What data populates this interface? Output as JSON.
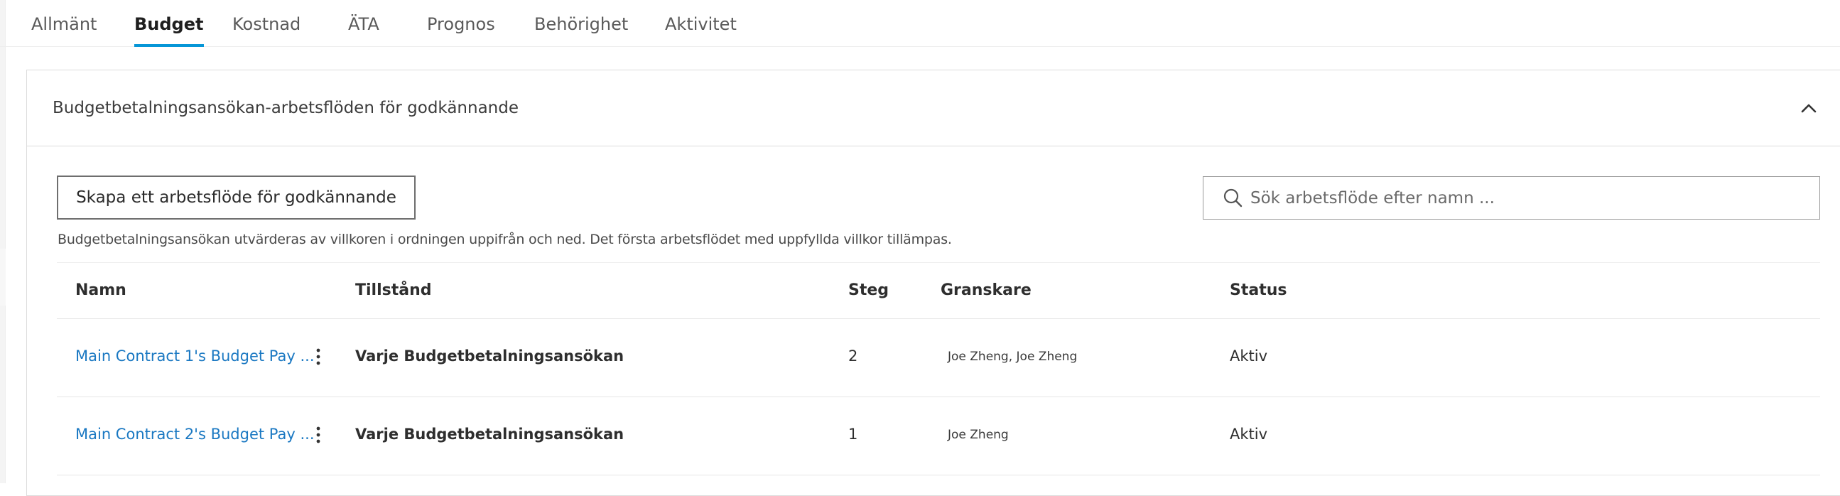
{
  "tabs": [
    {
      "label": "Allmänt",
      "active": false
    },
    {
      "label": "Budget",
      "active": true
    },
    {
      "label": "Kostnad",
      "active": false
    },
    {
      "label": "ÄTA",
      "active": false
    },
    {
      "label": "Prognos",
      "active": false
    },
    {
      "label": "Behörighet",
      "active": false
    },
    {
      "label": "Aktivitet",
      "active": false
    }
  ],
  "panel": {
    "title": "Budgetbetalningsansökan-arbetsflöden för godkännande",
    "collapse_icon": "chevron-up-icon",
    "create_button_label": "Skapa ett arbetsflöde för godkännande",
    "search": {
      "placeholder": "Sök arbetsflöde efter namn ...",
      "value": "",
      "icon": "search-icon"
    },
    "info_text": "Budgetbetalningsansökan utvärderas av villkoren i ordningen uppifrån och ned. Det första arbetsflödet med uppfyllda villkor tillämpas."
  },
  "table": {
    "columns": [
      "Namn",
      "Tillstånd",
      "Steg",
      "Granskare",
      "Status"
    ],
    "rows": [
      {
        "name": "Main Contract 1's Budget Pay ...",
        "state": "Varje Budgetbetalningsansökan",
        "steps": "2",
        "reviewers": "Joe Zheng, Joe Zheng",
        "status": "Aktiv"
      },
      {
        "name": "Main Contract 2's Budget Pay ...",
        "state": "Varje Budgetbetalningsansökan",
        "steps": "1",
        "reviewers": "Joe Zheng",
        "status": "Aktiv"
      }
    ]
  },
  "colors": {
    "accent": "#0696d7",
    "link": "#1a78c2",
    "border": "#dcdcdc"
  }
}
